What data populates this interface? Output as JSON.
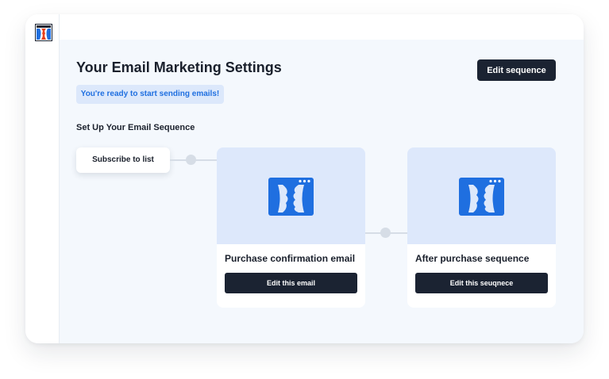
{
  "app": {
    "logo_icon": "clickfunnels-logo-icon",
    "brand_color": "#1f6fe0"
  },
  "header": {
    "title": "Your Email Marketing Settings",
    "edit_sequence_label": "Edit sequence"
  },
  "banner": {
    "text": "You're ready to start sending emails!"
  },
  "sequence": {
    "title": "Set Up Your Email Sequence",
    "trigger_label": "Subscribe to list",
    "steps": [
      {
        "icon": "clickfunnels-logo-icon",
        "title": "Purchase confirmation email",
        "button_label": "Edit this email"
      },
      {
        "icon": "clickfunnels-logo-icon",
        "title": "After purchase sequence",
        "button_label": "Edit this seuqnece"
      }
    ]
  },
  "colors": {
    "button_dark": "#1b2332",
    "banner_bg": "#dce8fb",
    "card_image_bg": "#dde8fb",
    "main_bg": "#f4f8fd"
  }
}
